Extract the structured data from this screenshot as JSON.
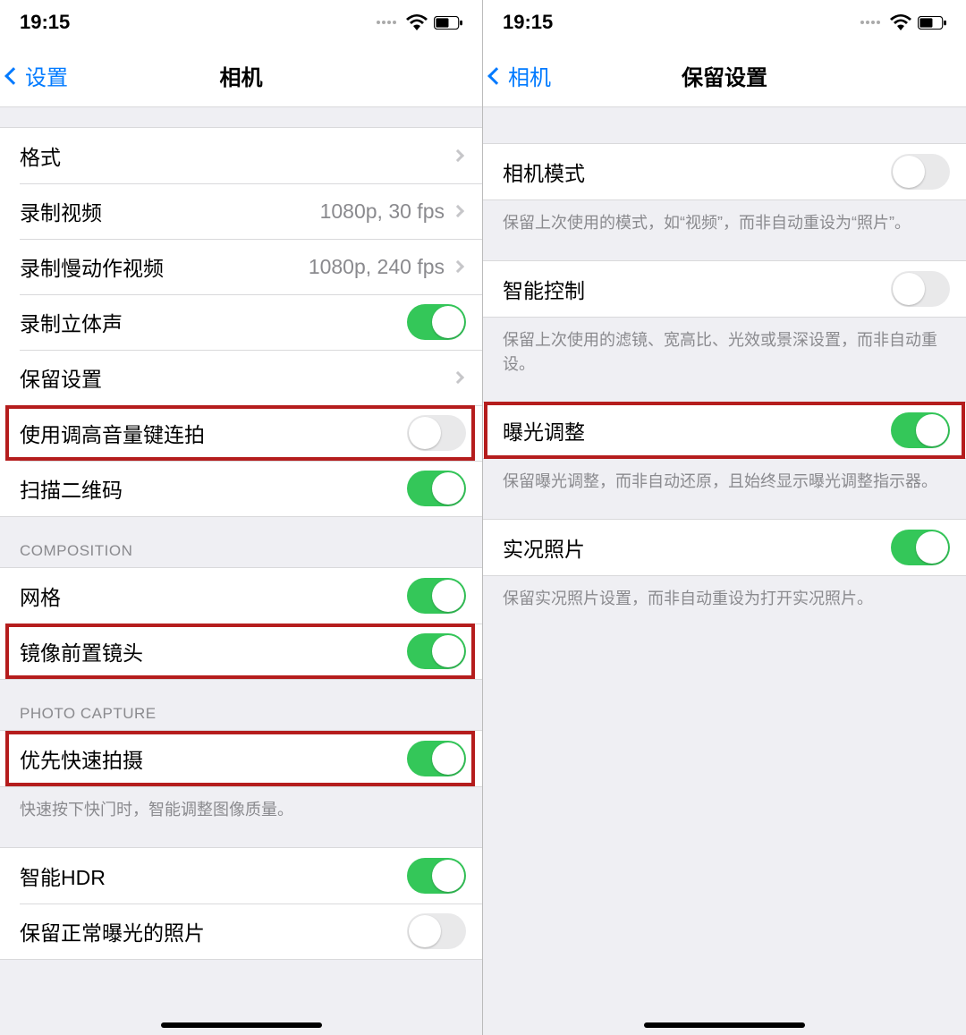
{
  "time": "19:15",
  "left_screen": {
    "back_label": "设置",
    "title": "相机",
    "rows": {
      "formats": "格式",
      "record_video_label": "录制视频",
      "record_video_value": "1080p, 30 fps",
      "slomo_label": "录制慢动作视频",
      "slomo_value": "1080p, 240 fps",
      "stereo": "录制立体声",
      "preserve": "保留设置",
      "vol_burst": "使用调高音量键连拍",
      "scan_qr": "扫描二维码"
    },
    "section_composition": "COMPOSITION",
    "comp": {
      "grid": "网格",
      "mirror_front": "镜像前置镜头"
    },
    "section_photo": "PHOTO CAPTURE",
    "photo": {
      "faster_shooting": "优先快速拍摄",
      "faster_note": "快速按下快门时，智能调整图像质量。",
      "smart_hdr": "智能HDR",
      "keep_normal": "保留正常曝光的照片"
    }
  },
  "right_screen": {
    "back_label": "相机",
    "title": "保留设置",
    "camera_mode": "相机模式",
    "camera_mode_note": "保留上次使用的模式，如“视频”，而非自动重设为“照片”。",
    "smart_control": "智能控制",
    "smart_control_note": "保留上次使用的滤镜、宽高比、光效或景深设置，而非自动重设。",
    "exposure": "曝光调整",
    "exposure_note": "保留曝光调整，而非自动还原，且始终显示曝光调整指示器。",
    "live_photo": "实况照片",
    "live_photo_note": "保留实况照片设置，而非自动重设为打开实况照片。"
  }
}
